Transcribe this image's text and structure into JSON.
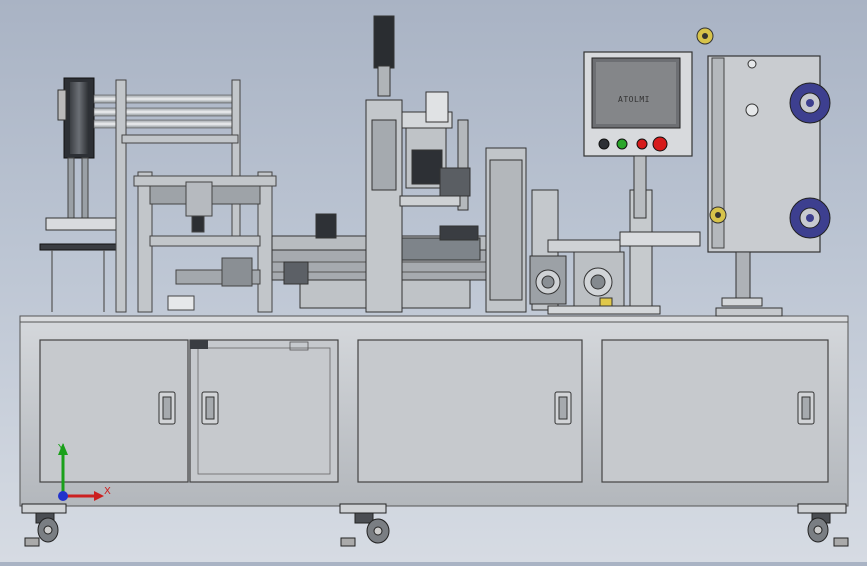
{
  "scene": {
    "description_colors": {
      "background_top": "#a9b3c4",
      "background_bottom": "#d6dbe3",
      "steel": "#bfc3c8",
      "steel_dark": "#8e9398",
      "cabinet": "#c8cacd",
      "reel_blue": "#3d3f8f",
      "button_green": "#2aa62a",
      "button_red": "#d61b1b"
    }
  },
  "hmi": {
    "screen_text": "ATOLMI"
  },
  "triad": {
    "x_label": "X",
    "y_label": "Y"
  }
}
